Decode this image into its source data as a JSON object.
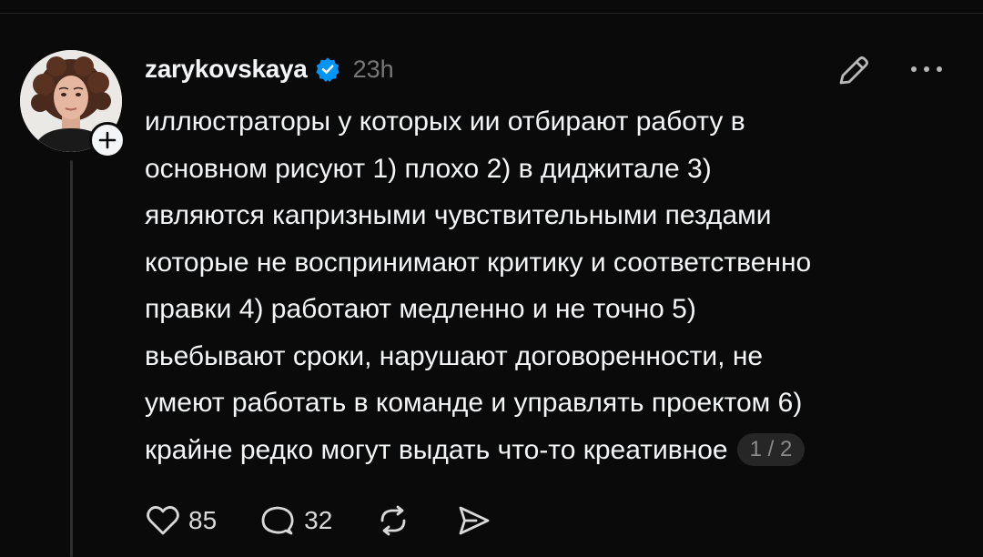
{
  "post": {
    "username": "zarykovskaya",
    "verified": true,
    "timestamp": "23h",
    "lines": [
      "иллюстраторы у которых ии отбирают работу в",
      "основном рисуют 1) плохо 2) в диджитале 3)",
      "являются капризными чувствительными пездами",
      "которые не воспринимают критику и соответственно",
      "правки 4) работают медленно и не точно 5)",
      "вьебывают сроки, нарушают договоренности, не",
      "умеют работать в команде и управлять проектом 6)",
      "крайне редко могут выдать что-то креативное"
    ],
    "page_indicator": "1 / 2"
  },
  "actions": {
    "likes": "85",
    "replies": "32"
  },
  "icons": {
    "follow": "plus-icon",
    "verified": "verified-badge-icon",
    "edit": "pencil-icon",
    "more": "more-dots-icon",
    "like": "heart-icon",
    "reply": "comment-bubble-icon",
    "repost": "repost-icon",
    "share": "send-icon"
  },
  "colors": {
    "background": "#0a0a0a",
    "text": "#f3f5f7",
    "muted": "#777777",
    "verified": "#0095f6"
  }
}
